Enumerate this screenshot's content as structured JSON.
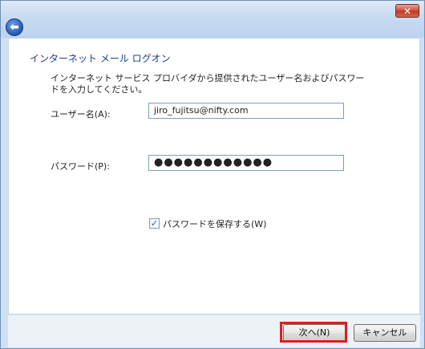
{
  "window": {
    "close_label": "✕",
    "back_label": "⬅"
  },
  "page": {
    "heading": "インターネット メール ログオン",
    "description": "インターネット サービス プロバイダから提供されたユーザー名およびパスワードを入力してください。"
  },
  "form": {
    "username_label": "ユーザー名(A):",
    "username_value": "jiro_fujitsu@nifty.com",
    "password_label": "パスワード(P):",
    "password_value": "●●●●●●●●●●●●",
    "remember_label": "パスワードを保存する(W)",
    "remember_checked": "✓"
  },
  "buttons": {
    "next": "次へ(N)",
    "cancel": "キャンセル"
  },
  "colors": {
    "highlight": "#e21c1c",
    "accent": "#1e3f8a"
  }
}
